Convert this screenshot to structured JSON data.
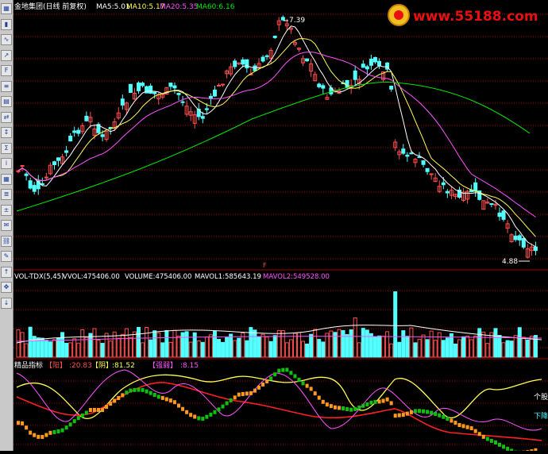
{
  "price_panel": {
    "title": "金地集团(日线 前复权)",
    "ma5": "MA5:5.01",
    "ma10": "MA10:5.17",
    "ma20": "MA20:5.35",
    "ma60": "MA60:6.16",
    "high_marker": "7.39",
    "low_marker": "4.88",
    "f_marker": "F"
  },
  "volume_panel": {
    "title": "VOL-TDX(5,45)",
    "vvol": "VVOL:475406.00",
    "volume": "VOLUME:475406.00",
    "mavol1": "MAVOL1:585643.19",
    "mavol2": "MAVOL2:549528.00"
  },
  "indicator_panel": {
    "title": "精品指标",
    "yang_label": "【阳】",
    "yang_value": ":20.83",
    "yin_label": "【阴】",
    "yin_value": ":81.52",
    "qiangruo_label": "【强弱】",
    "qiangruo_value": ":8.15",
    "right_label_1": "个股",
    "right_label_2": "下降"
  },
  "logo": {
    "text": "www.55188.com"
  },
  "colors": {
    "background": "#000000",
    "up_candle": "#ff5050",
    "down_candle": "#54ffff",
    "ma5": "#ffffff",
    "ma10": "#ffff54",
    "ma20": "#ff54ff",
    "ma60": "#00e800",
    "grid": "#a00000",
    "logo_red": "#e81010"
  },
  "toolbar_icons": [
    "chart-icon",
    "kline-icon",
    "minute-icon",
    "trend-icon",
    "f10-icon",
    "news-icon",
    "report-icon",
    "compare-icon",
    "sort-icon",
    "stat-icon",
    "info-icon",
    "grid-icon",
    "list-icon",
    "calc-icon",
    "msg-icon",
    "link-icon",
    "pen-icon",
    "arrow-up-icon",
    "cross-icon",
    "arrow-down-icon"
  ]
}
